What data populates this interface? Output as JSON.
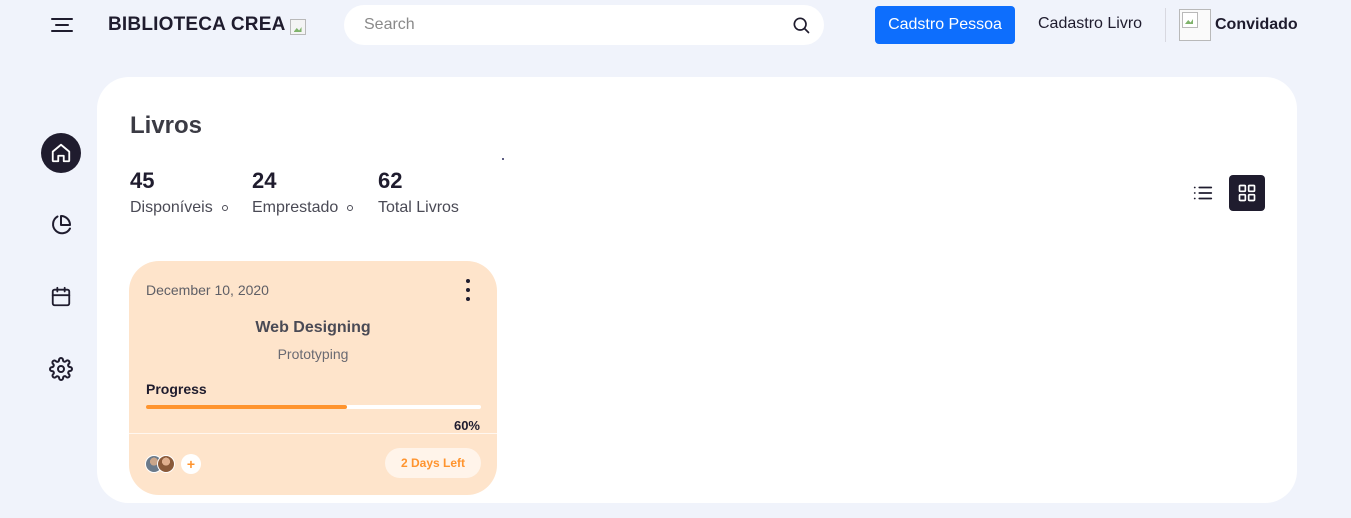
{
  "header": {
    "app_title": "BIBLIOTECA CREA",
    "search_placeholder": "Search",
    "search_value": "",
    "primary_button": "Cadstro Pessoa",
    "nav_link": "Cadastro Livro",
    "user_name": "Convidado"
  },
  "sidebar": {
    "items": [
      {
        "icon": "home-icon",
        "active": true
      },
      {
        "icon": "pie-chart-icon",
        "active": false
      },
      {
        "icon": "calendar-icon",
        "active": false
      },
      {
        "icon": "settings-icon",
        "active": false
      }
    ]
  },
  "main": {
    "title": "Livros",
    "stats": [
      {
        "value": "45",
        "label": "Disponíveis"
      },
      {
        "value": "24",
        "label": "Emprestado"
      },
      {
        "value": "62",
        "label": "Total Livros"
      }
    ],
    "view_modes": [
      {
        "icon": "list-view-icon",
        "active": false
      },
      {
        "icon": "grid-view-icon",
        "active": true
      }
    ]
  },
  "card": {
    "date": "December 10, 2020",
    "title": "Web Designing",
    "subtitle": "Prototyping",
    "progress_label": "Progress",
    "progress_value": 0.6,
    "progress_text": "60%",
    "add_label": "+",
    "days_left": "2 Days Left",
    "colors": {
      "background": "#fee4cb",
      "accent": "#ff942e"
    }
  },
  "colors": {
    "primary_button": "#0d6efd",
    "dark": "#1f1c2e",
    "page_bg": "#f0f3fb"
  }
}
